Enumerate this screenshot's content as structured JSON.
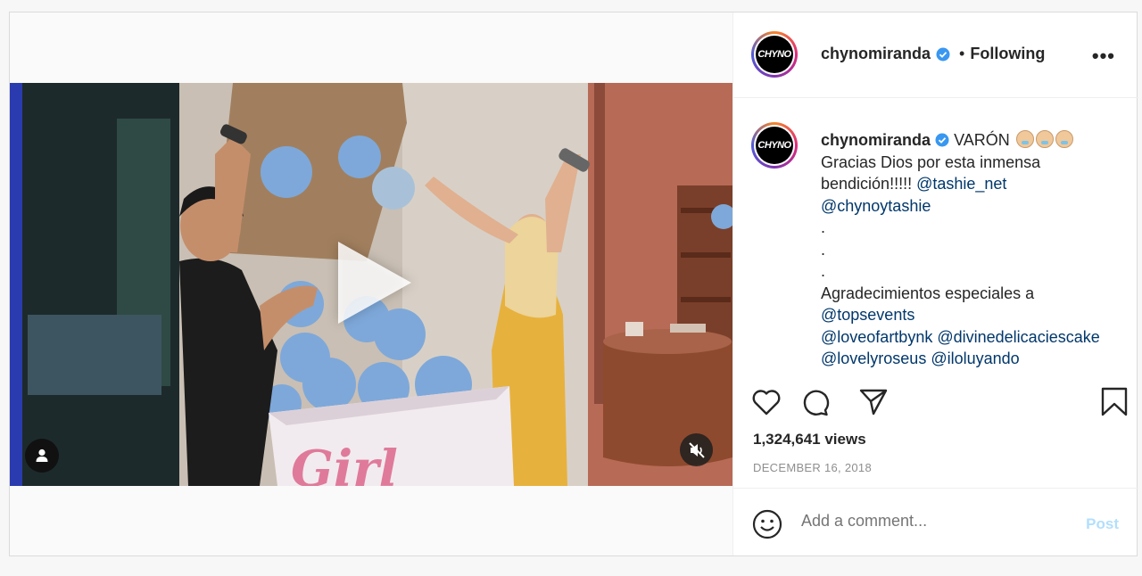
{
  "header": {
    "avatar_text": "CHYNO",
    "username": "chynomiranda",
    "separator": "•",
    "follow_status": "Following",
    "more_label": "•••"
  },
  "caption": {
    "username": "chynomiranda",
    "text_1": "VARÓN",
    "text_2": "Gracias Dios por esta inmensa bendición!!!!!",
    "mention_1": "@tashie_net",
    "mention_2": "@chynoytashie",
    "dot": ".",
    "text_3": "Agradecimientos especiales a",
    "mention_3": "@topsevents",
    "mention_4": "@loveofartbynk",
    "mention_5": "@divinedelicaciescake",
    "mention_6": "@lovelyroseus",
    "mention_7": "@iloluyando"
  },
  "stats": {
    "views": "1,324,641 views",
    "date": "DECEMBER 16, 2018"
  },
  "comment": {
    "placeholder": "Add a comment...",
    "post_label": "Post"
  },
  "video": {
    "box_text": "Girl"
  },
  "colors": {
    "accent_link": "#00376b",
    "verified": "#3897f0",
    "post_disabled": "#b2dffc"
  }
}
